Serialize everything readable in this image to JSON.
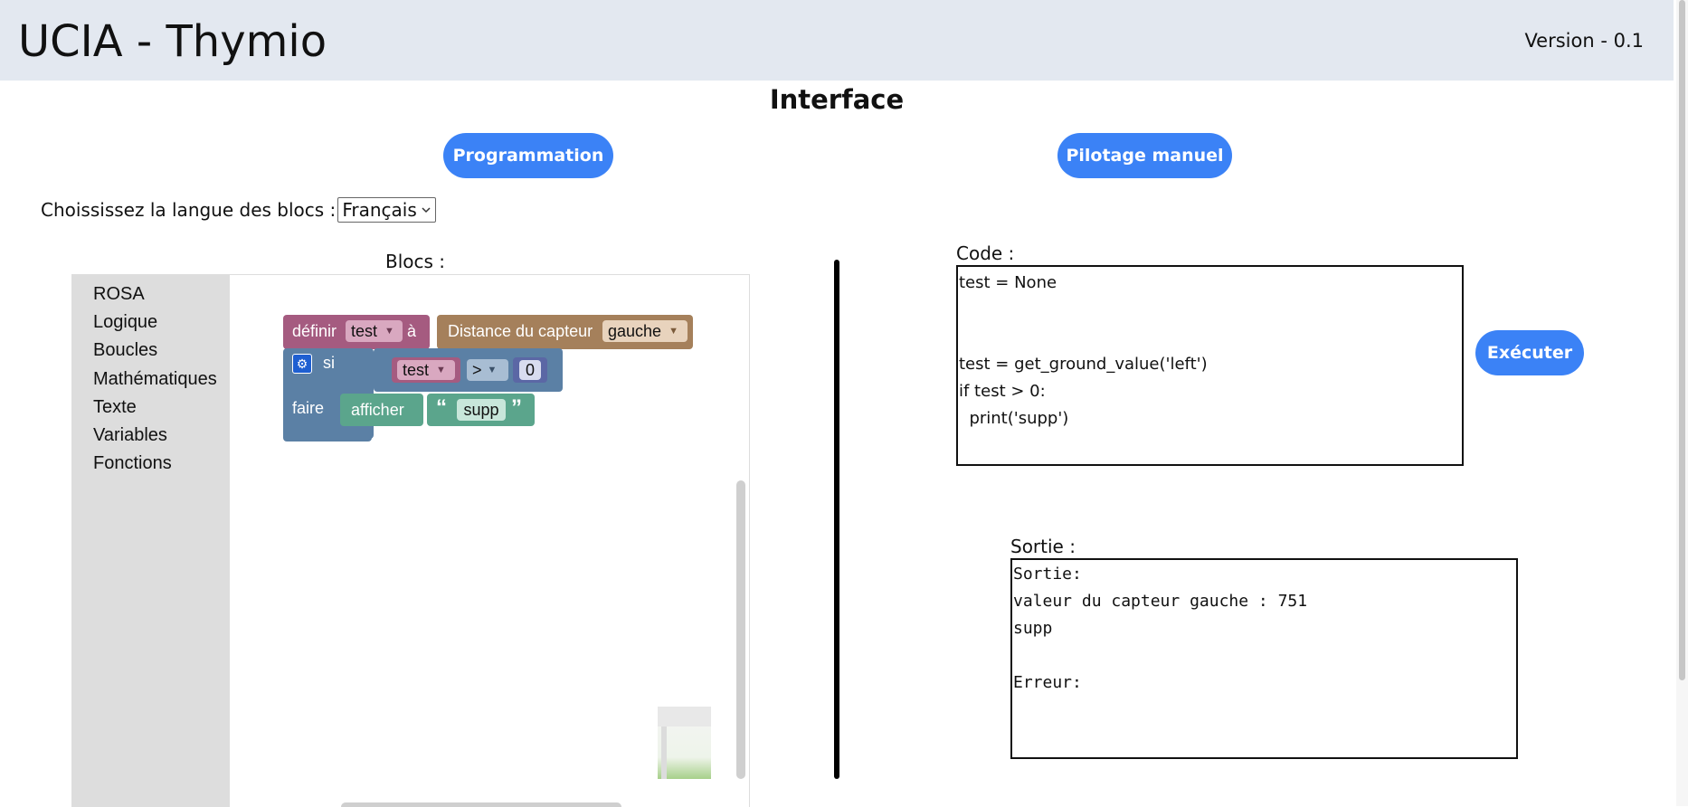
{
  "header": {
    "title": "UCIA - Thymio",
    "version": "Version - 0.1"
  },
  "page_title": "Interface",
  "modes": {
    "programming": "Programmation",
    "manual": "Pilotage manuel"
  },
  "language": {
    "label": "Choississez la langue des blocs :",
    "selected": "Français"
  },
  "blocks_label": "Blocs :",
  "toolbox": [
    "ROSA",
    "Logique",
    "Boucles",
    "Mathématiques",
    "Texte",
    "Variables",
    "Fonctions"
  ],
  "blocks": {
    "set_keyword": "définir",
    "set_var": "test",
    "to_keyword": "à",
    "sensor_label": "Distance du capteur",
    "sensor_side": "gauche",
    "if_keyword": "si",
    "compare_var": "test",
    "operator": ">",
    "number": "0",
    "do_keyword": "faire",
    "print_keyword": "afficher",
    "open_quote": "“",
    "text_value": "supp",
    "close_quote": "”"
  },
  "code": {
    "label": "Code :",
    "lines": [
      "test = None",
      "",
      "",
      "test = get_ground_value('left')",
      "if test > 0:",
      "  print('supp')"
    ]
  },
  "execute_label": "Exécuter",
  "output": {
    "label": "Sortie :",
    "lines": [
      "Sortie:",
      "valeur du capteur gauche : 751",
      "supp",
      "",
      "Erreur:"
    ]
  },
  "colors": {
    "accent": "#3b82f6",
    "header_bg": "#e3e8f0",
    "variables_block": "#a55b80",
    "sensor_block": "#a5805b",
    "logic_block": "#5b80a5",
    "text_block": "#5ba58c"
  }
}
